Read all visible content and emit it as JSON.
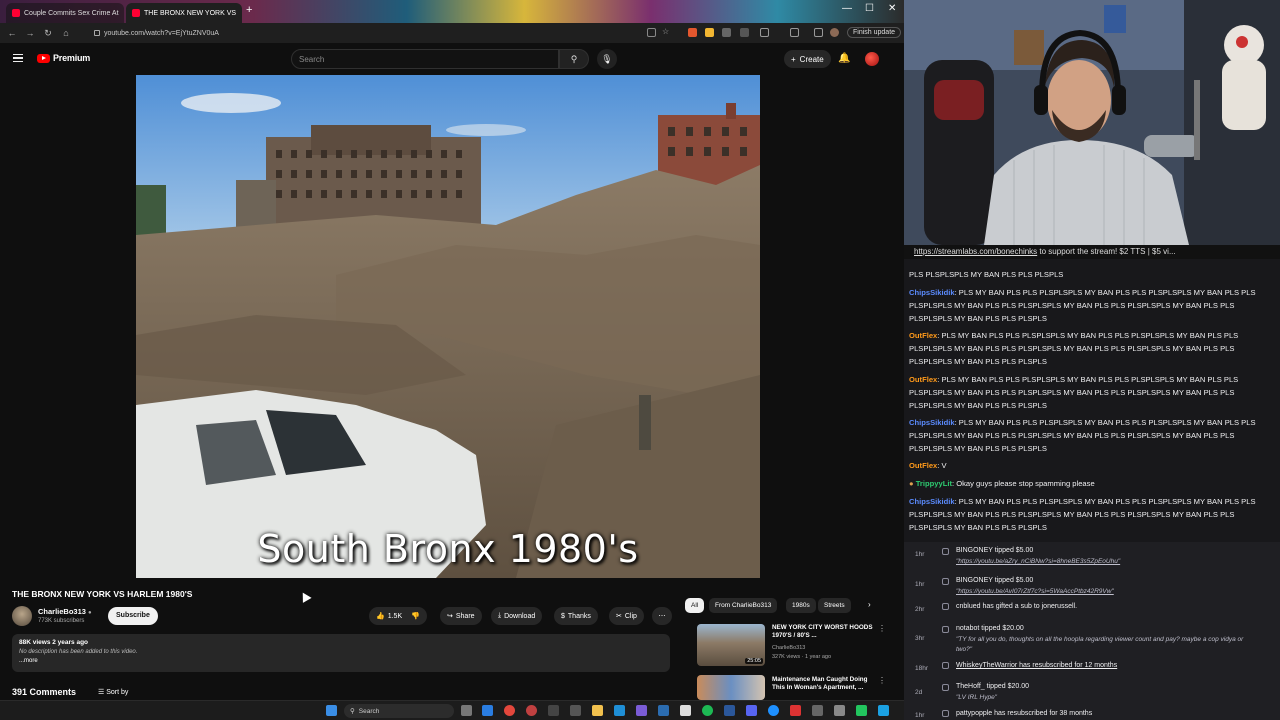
{
  "browser": {
    "tabs": [
      {
        "label": "Couple Commits Sex Crime At",
        "active": false
      },
      {
        "label": "THE BRONX NEW YORK VS",
        "active": true
      }
    ],
    "new_tab": "+",
    "url": "youtube.com/watch?v=EjYtuZNV0uA",
    "finish_update": "Finish update"
  },
  "youtube": {
    "logo_text": "Premium",
    "search_placeholder": "Search",
    "create_label": "Create",
    "video_caption": "South Bronx 1980's",
    "title": "THE BRONX NEW YORK VS HARLEM 1980'S",
    "channel": {
      "name": "CharlieBo313",
      "subscribers": "773K subscribers",
      "subscribe_label": "Subscribe"
    },
    "actions": {
      "likes": "1.5K",
      "share": "Share",
      "download": "Download",
      "thanks": "Thanks",
      "clip": "Clip"
    },
    "description": {
      "meta": "88K views  2 years ago",
      "body": "No description has been added to this video.",
      "more": "...more"
    },
    "comments": {
      "count_label": "391 Comments",
      "sort_label": "Sort by"
    },
    "chips": [
      "All",
      "From CharlieBo313",
      "1980s",
      "Streets"
    ],
    "related": [
      {
        "title": "NEW YORK CITY WORST HOODS 1970'S / 80'S ...",
        "channel": "CharlieBo313",
        "meta": "327K views · 1 year ago",
        "duration": "25:05"
      },
      {
        "title": "Maintenance Man Caught Doing This In Woman's Apartment, ...",
        "channel": "",
        "meta": "",
        "duration": ""
      }
    ]
  },
  "taskbar": {
    "search_label": "Search"
  },
  "chat": {
    "banner_link": "https://streamlabs.com/bonechinks",
    "banner_text": " to support the stream! $2 TTS | $5 vi...",
    "messages": [
      {
        "user": "",
        "color": "#efeff1",
        "text": "PLS PLSPLSPLS MY BAN PLS PLS PLSPLS"
      },
      {
        "user": "ChipsSikidik",
        "color": "#5b8cff",
        "text": ": PLS MY BAN PLS PLS PLSPLSPLS MY BAN PLS PLS PLSPLSPLS MY BAN PLS PLS PLSPLSPLS MY BAN PLS PLS PLSPLSPLS MY BAN PLS PLS PLSPLSPLS MY BAN PLS PLS PLSPLSPLS MY BAN PLS PLS PLSPLS"
      },
      {
        "user": "OutFlex",
        "color": "#ff9a1a",
        "text": ": PLS MY BAN PLS PLS PLSPLSPLS MY BAN PLS PLS PLSPLSPLS MY BAN PLS PLS PLSPLSPLS MY BAN PLS PLS PLSPLSPLS MY BAN PLS PLS PLSPLSPLS MY BAN PLS PLS PLSPLSPLS MY BAN PLS PLS PLSPLS"
      },
      {
        "user": "OutFlex",
        "color": "#ff9a1a",
        "text": ": PLS MY BAN PLS PLS PLSPLSPLS MY BAN PLS PLS PLSPLSPLS MY BAN PLS PLS PLSPLSPLS MY BAN PLS PLS PLSPLSPLS MY BAN PLS PLS PLSPLSPLS MY BAN PLS PLS PLSPLSPLS MY BAN PLS PLS PLSPLS"
      },
      {
        "user": "ChipsSikidik",
        "color": "#5b8cff",
        "text": ": PLS MY BAN PLS PLS PLSPLSPLS MY BAN PLS PLS PLSPLSPLS MY BAN PLS PLS PLSPLSPLS MY BAN PLS PLS PLSPLSPLS MY BAN PLS PLS PLSPLSPLS MY BAN PLS PLS PLSPLSPLS MY BAN PLS PLS PLSPLS"
      },
      {
        "user": "OutFlex",
        "color": "#ff9a1a",
        "text": ": V"
      },
      {
        "user": "TrippyyLit",
        "color": "#2ecc71",
        "text": ": Okay guys please stop spamming please"
      },
      {
        "user": "ChipsSikidik",
        "color": "#5b8cff",
        "text": ": PLS MY BAN PLS PLS PLSPLSPLS MY BAN PLS PLS PLSPLSPLS MY BAN PLS PLS PLSPLSPLS MY BAN PLS PLS PLSPLSPLS MY BAN PLS PLS PLSPLSPLS MY BAN PLS PLS PLSPLSPLS MY BAN PLS PLS PLSPLS"
      }
    ],
    "events": [
      {
        "time": "1hr",
        "line": "BINGONEY tipped $5.00",
        "sub": "\"https://youtu.be/aZry_nCiBNw?si=8hneBE3s5ZpEoUhu\"",
        "sub_link": true
      },
      {
        "time": "1hr",
        "line": "BINGONEY tipped $5.00",
        "sub": "\"https://youtu.be/AvI07rZtf7c?si=5WaAccPtbz42R9Vw\"",
        "sub_link": true
      },
      {
        "time": "2hr",
        "line": "cnblued has gifted a sub to jonerussell.",
        "sub": "",
        "sub_link": false
      },
      {
        "time": "3hr",
        "line": "notabot tipped $20.00",
        "sub": "\"TY for all you do, thoughts on all the hoopla regarding viewer count and pay? maybe a cop vidya or",
        "sub2": "two?\"",
        "sub_link": false
      },
      {
        "time": "18hr",
        "line": "WhiskeyTheWarrior has resubscribed for 12 months",
        "sub": "",
        "sub_link": false
      },
      {
        "time": "2d",
        "line": "TheHoff_ tipped $20.00",
        "sub": "\"LV IRL Hype\"",
        "sub_link": false
      },
      {
        "time": "1hr",
        "line": "pattypopple has resubscribed for 38 months",
        "sub": "",
        "sub_link": false
      }
    ]
  }
}
